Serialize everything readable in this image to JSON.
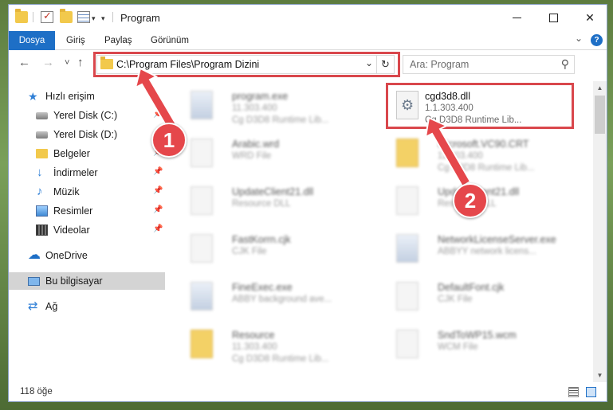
{
  "window": {
    "title": "Program",
    "controls": {
      "minimize_icon": "minimize-icon",
      "maximize_icon": "maximize-icon",
      "close_label": "✕"
    }
  },
  "quick_access_toolbar": {
    "caret": "▾"
  },
  "ribbon": {
    "tabs": [
      {
        "label": "Dosya",
        "active": true
      },
      {
        "label": "Giriş"
      },
      {
        "label": "Paylaş"
      },
      {
        "label": "Görünüm"
      }
    ],
    "expand_icon": "⌄",
    "help_label": "?"
  },
  "navigation": {
    "back": "←",
    "forward": "→",
    "recent": "˅",
    "up": "↑"
  },
  "address_bar": {
    "path": "C:\\Program Files\\Program Dizini",
    "dropdown": "⌄",
    "refresh": "↻"
  },
  "search": {
    "placeholder": "Ara: Program",
    "icon": "search-icon"
  },
  "sidebar": {
    "items": [
      {
        "label": "Hızlı erişim",
        "icon": "star-icon",
        "pinned": false
      },
      {
        "label": "Yerel Disk (C:)",
        "icon": "drive-icon",
        "pinned": true
      },
      {
        "label": "Yerel Disk (D:)",
        "icon": "drive-icon",
        "pinned": true
      },
      {
        "label": "Belgeler",
        "icon": "documents-icon",
        "pinned": true
      },
      {
        "label": "İndirmeler",
        "icon": "download-icon",
        "pinned": true
      },
      {
        "label": "Müzik",
        "icon": "music-icon",
        "pinned": true
      },
      {
        "label": "Resimler",
        "icon": "pictures-icon",
        "pinned": true
      },
      {
        "label": "Videolar",
        "icon": "videos-icon",
        "pinned": true
      },
      {
        "label": "OneDrive",
        "icon": "cloud-icon",
        "pinned": false
      },
      {
        "label": "Bu bilgisayar",
        "icon": "computer-icon",
        "pinned": false,
        "selected": true
      },
      {
        "label": "Ağ",
        "icon": "network-icon",
        "pinned": false
      }
    ],
    "pin_glyph": "📌"
  },
  "files": [
    {
      "name": "program.exe",
      "line1": "11.303.400",
      "line2": "Cg D3D8 Runtime Lib...",
      "icon": "exe-icon"
    },
    {
      "name": "cgd3d8.dll",
      "line1": "1.1.303.400",
      "line2": "Cg D3D8 Runtime Lib...",
      "icon": "dll-gear-icon",
      "highlighted": true
    },
    {
      "name": "Arabic.wrd",
      "line1": "WRD File",
      "line2": "",
      "icon": "file-icon"
    },
    {
      "name": "Microsoft.VC90.CRT",
      "line1": "11.303.400",
      "line2": "Cg D3D8 Runtime Lib...",
      "icon": "folder-icon"
    },
    {
      "name": "UpdateClient21.dll",
      "line1": "Resource DLL",
      "line2": "",
      "icon": "dll-gear-icon"
    },
    {
      "name": "UpdateClient21.dll",
      "line1": "Resource DLL",
      "line2": "",
      "icon": "dll-gear-icon"
    },
    {
      "name": "FastKorrn.cjk",
      "line1": "CJK File",
      "line2": "",
      "icon": "file-icon"
    },
    {
      "name": "NetworkLicenseServer.exe",
      "line1": "ABBYY network licens...",
      "line2": "",
      "icon": "exe-icon"
    },
    {
      "name": "FineExec.exe",
      "line1": "ABBY background ave...",
      "line2": "",
      "icon": "exe-icon"
    },
    {
      "name": "DefaultFont.cjk",
      "line1": "CJK File",
      "line2": "",
      "icon": "file-icon"
    },
    {
      "name": "Resource",
      "line1": "11.303.400",
      "line2": "Cg D3D8 Runtime Lib...",
      "icon": "folder-icon"
    },
    {
      "name": "SndToWP15.wcm",
      "line1": "WCM File",
      "line2": "",
      "icon": "file-icon"
    }
  ],
  "status_bar": {
    "count": "118 öğe"
  },
  "scrollbar": {
    "up": "▲",
    "down": "▼"
  },
  "annotations": {
    "step1": "1",
    "step2": "2",
    "color": "#e5474b"
  }
}
